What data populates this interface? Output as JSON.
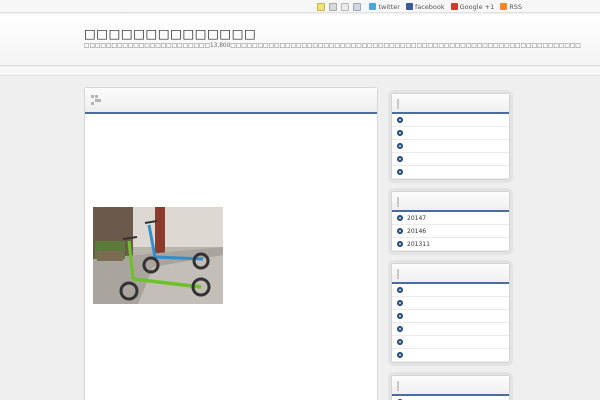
{
  "topbar": {
    "twitter_label": "twitter",
    "facebook_label": "facebook",
    "google_label": "Google +1",
    "rss_label": "RSS"
  },
  "header": {
    "title": "□□□□□□□□□□□□□□",
    "description": "□□□□□□□□□□□□□□□□□□□□□□□13,800□□□□□□□□□□□□□□□□□□□□□□□□□□□□□□□□□□□□□□□□□□□□□□□□□□□□□□□□□□□□□□□□"
  },
  "sidebar": {
    "widget1": {
      "items": [
        "",
        "",
        "",
        "",
        ""
      ]
    },
    "archives": {
      "items": [
        "20147",
        "20146",
        "201311"
      ]
    },
    "widget3": {
      "items": [
        "",
        "",
        "",
        "",
        "",
        ""
      ]
    },
    "widget4": {
      "items": [
        ""
      ]
    }
  },
  "colors": {
    "accent_line": "#4b6d9c",
    "bullet": "#2f5a8c",
    "twitter": "#4aa7d9",
    "facebook": "#3b5998",
    "google": "#d23c2a",
    "rss": "#f08a24"
  }
}
